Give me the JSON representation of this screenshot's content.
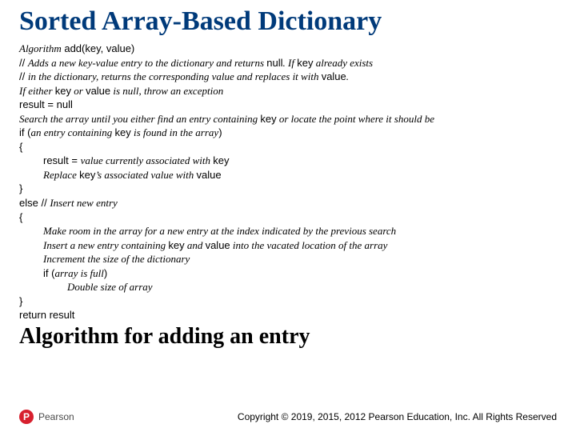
{
  "title": "Sorted Array-Based Dictionary",
  "l1_a": "Algorithm",
  "l1_b": " add(key, value)",
  "l2_a": "// ",
  "l2_b": "Adds a new key-value entry to the dictionary and returns ",
  "l2_c": "null",
  "l2_d": ". If ",
  "l2_e": "key",
  "l2_f": " already exists",
  "l3_a": "// ",
  "l3_b": "in the dictionary, returns the corresponding value and replaces it with ",
  "l3_c": "value",
  "l3_d": ".",
  "l4_a": "If either ",
  "l4_b": "key",
  "l4_c": " or ",
  "l4_d": "value",
  "l4_e": " is null, throw an exception",
  "l5": "result = null",
  "l6_a": "Search the array until you either find an entry containing ",
  "l6_b": "key",
  "l6_c": " or locate the point where it should be",
  "l7_a": "if",
  "l7_b": " (",
  "l7_c": "an entry containing ",
  "l7_d": "key",
  "l7_e": " is found in the array",
  "l7_f": ")",
  "l8": "{",
  "l9_a": "result = ",
  "l9_b": "value currently associated with ",
  "l9_c": "key",
  "l10_a": "Replace ",
  "l10_b": "key",
  "l10_c": "’s associated value with ",
  "l10_d": "value",
  "l11": "}",
  "l12_a": "else",
  "l12_b": " // ",
  "l12_c": "Insert new entry",
  "l13": "{",
  "l14": "Make room in the array for a new entry at the index indicated by the previous search",
  "l15_a": "Insert a new entry containing ",
  "l15_b": "key",
  "l15_c": " and ",
  "l15_d": "value",
  "l15_e": " into the vacated location of the array",
  "l16": "Increment the size of the dictionary",
  "l17_a": "if",
  "l17_b": " (",
  "l17_c": "array is full",
  "l17_d": ")",
  "l18": "Double size of array",
  "l19": "}",
  "l20_a": "return",
  "l20_b": " result",
  "subtitle": "Algorithm for adding an entry",
  "logo_letter": "P",
  "logo_name": "Pearson",
  "copyright": "Copyright © 2019, 2015, 2012 Pearson Education, Inc. All Rights Reserved"
}
